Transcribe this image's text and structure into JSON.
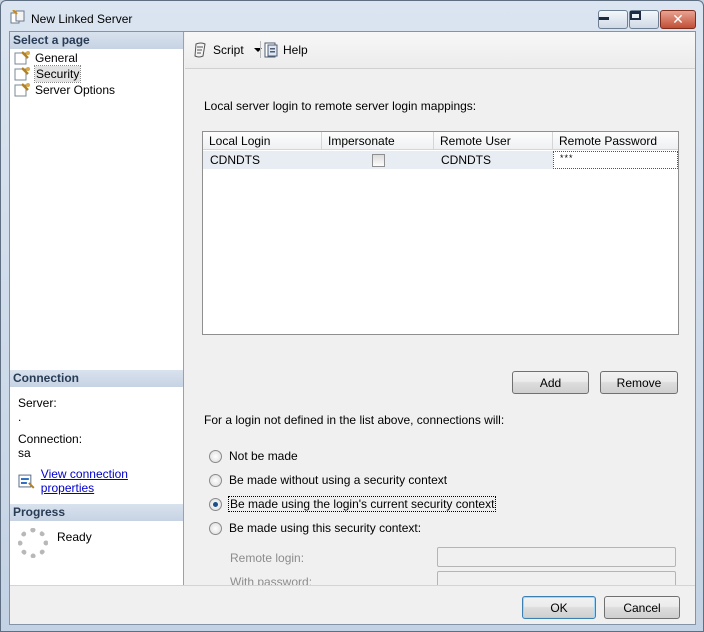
{
  "window": {
    "title": "New Linked Server"
  },
  "left_pane": {
    "select_page_header": "Select a page",
    "pages": [
      {
        "label": "General",
        "icon": "page-wrench-icon"
      },
      {
        "label": "Security",
        "icon": "page-wrench-icon"
      },
      {
        "label": "Server Options",
        "icon": "page-wrench-icon"
      }
    ],
    "selected_page": "Security",
    "connection_header": "Connection",
    "server_label": "Server:",
    "server_value": ".",
    "connection_label": "Connection:",
    "connection_value": "sa",
    "view_connection_link": "View connection properties",
    "progress_header": "Progress",
    "progress_status": "Ready"
  },
  "toolbar": {
    "script_label": "Script",
    "help_label": "Help"
  },
  "security": {
    "mappings_label": "Local server login to remote server login mappings:",
    "columns": [
      "Local Login",
      "Impersonate",
      "Remote User",
      "Remote Password"
    ],
    "rows": [
      {
        "local_login": "CDNDTS",
        "impersonate": false,
        "remote_user": "CDNDTS",
        "remote_password": "***"
      }
    ],
    "add_label": "Add",
    "remove_label": "Remove",
    "undefined_login_label": "For a login not defined in the list above, connections will:",
    "options": [
      {
        "label": "Not be made",
        "checked": false
      },
      {
        "label": "Be made without using a security context",
        "checked": false
      },
      {
        "label": "Be made using the login's current security context",
        "checked": true
      },
      {
        "label": "Be made using this security context:",
        "checked": false
      }
    ],
    "remote_login_label": "Remote login:",
    "remote_login_value": "",
    "with_password_label": "With password:",
    "with_password_value": ""
  },
  "footer": {
    "ok_label": "OK",
    "cancel_label": "Cancel"
  },
  "colors": {
    "header_bg": "#c6d3e3",
    "link": "#0000cc",
    "grid_row_bg": "#e8edf3"
  }
}
